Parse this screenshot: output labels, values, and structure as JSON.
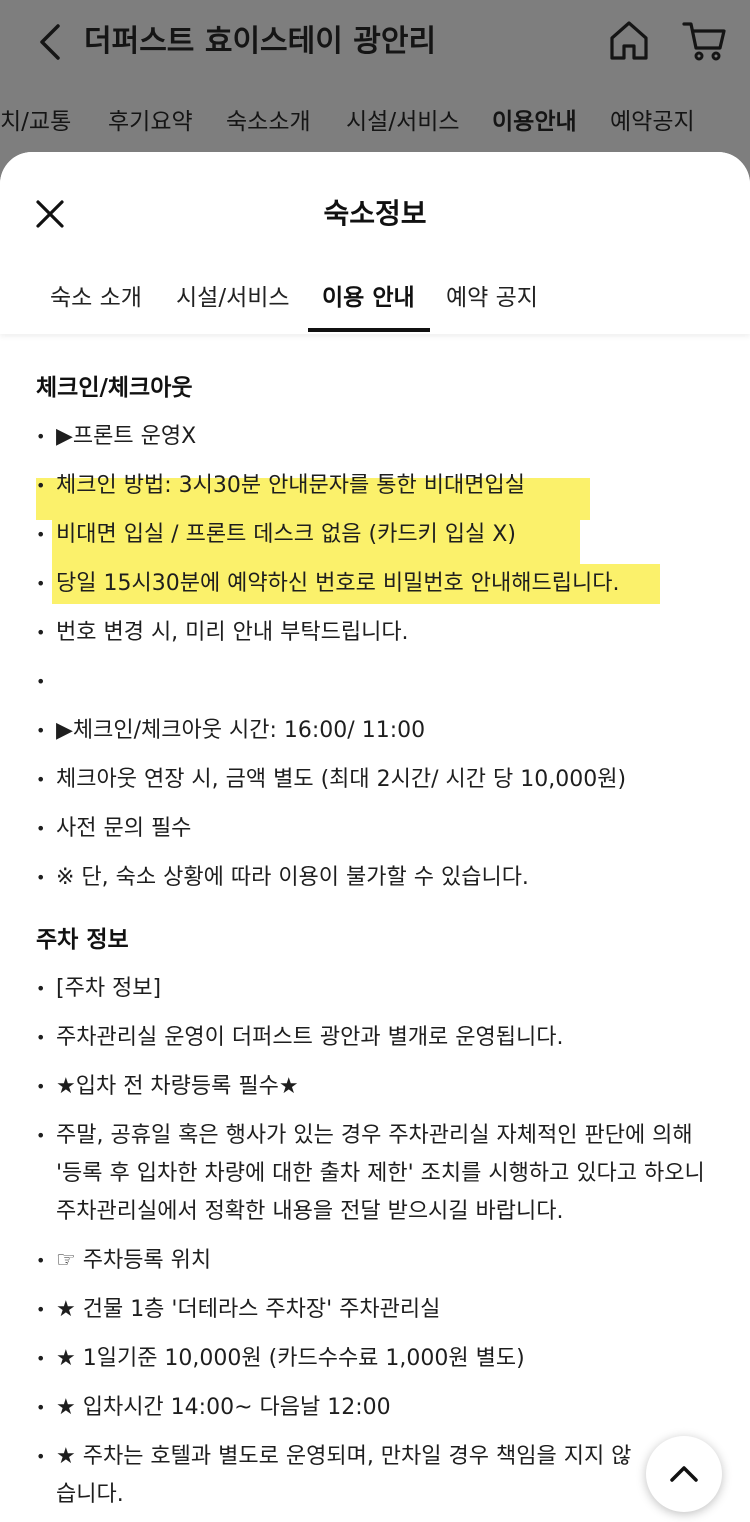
{
  "topbar": {
    "title": "더퍼스트 효이스테이 광안리",
    "nav_tabs": [
      "치/교통",
      "후기요약",
      "숙소소개",
      "시설/서비스",
      "이용안내",
      "예약공지"
    ],
    "active_nav_tab": "이용안내"
  },
  "sheet": {
    "title": "숙소정보",
    "tabs": [
      "숙소 소개",
      "시설/서비스",
      "이용 안내",
      "예약 공지"
    ],
    "active_tab": "이용 안내",
    "highlight_color": "#fbf16b"
  },
  "content": {
    "checkin_heading": "체크인/체크아웃",
    "checkin_items": [
      "▶프론트 운영X",
      "체크인 방법: 3시30분 안내문자를 통한 비대면입실",
      "비대면 입실 / 프론트 데스크 없음 (카드키 입실 X)",
      "당일 15시30분에 예약하신 번호로 비밀번호 안내해드립니다.",
      "번호 변경 시, 미리 안내 부탁드립니다.",
      "",
      "▶체크인/체크아웃 시간: 16:00/ 11:00",
      "체크아웃 연장 시, 금액 별도 (최대 2시간/ 시간 당 10,000원)",
      "사전 문의 필수",
      "※ 단, 숙소 상황에 따라 이용이 불가할 수 있습니다."
    ],
    "parking_heading": "주차 정보",
    "parking_items": [
      "[주차 정보]",
      "주차관리실 운영이 더퍼스트 광안과 별개로 운영됩니다.",
      "★입차 전 차량등록 필수★",
      "주말, 공휴일 혹은 행사가 있는 경우 주차관리실 자체적인 판단에 의해 '등록 후 입차한 차량에 대한 출차 제한' 조치를 시행하고 있다고 하오니 주차관리실에서 정확한 내용을 전달 받으시길 바랍니다.",
      "☞ 주차등록 위치",
      "★ 건물 1층 '더테라스 주차장' 주차관리실",
      "★ 1일기준 10,000원 (카드수수료 1,000원 별도)",
      "★ 입차시간 14:00~ 다음날 12:00",
      "★ 주차는 호텔과 별도로 운영되며, 만차일 경우 책임을 지지 않습니다."
    ]
  }
}
